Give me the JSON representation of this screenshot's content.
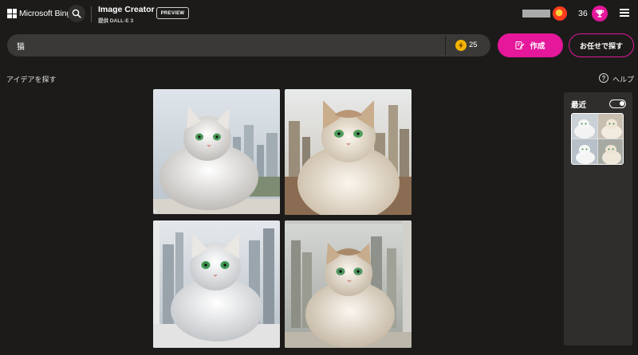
{
  "header": {
    "brand": "Microsoft Bing",
    "product_title": "Image Creator",
    "product_subtitle": "提供 DALL·E 3",
    "preview_badge": "PREVIEW",
    "reward_count": "36"
  },
  "search": {
    "query": "猫",
    "boost_count": "25",
    "create_label": "作成",
    "surprise_label": "お任せで探す"
  },
  "explore_label": "アイデアを探す",
  "help_label": "ヘルプ",
  "recent": {
    "title": "最近",
    "toggle_on": true
  },
  "results": [
    {
      "alt": "white fluffy cat with green eyes by window, city skyline"
    },
    {
      "alt": "cream and tan fluffy cat in front of skyscrapers"
    },
    {
      "alt": "white fluffy cat on window sill, city buildings"
    },
    {
      "alt": "tan and white cat on window ledge, city view"
    }
  ],
  "colors": {
    "background": "#1c1b1a",
    "accent": "#e5179a",
    "boost": "#f4b400",
    "panel": "#2f2e2d"
  }
}
